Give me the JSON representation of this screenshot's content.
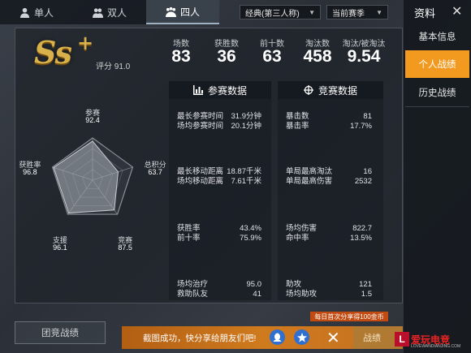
{
  "mode_tabs": [
    {
      "label": "单人",
      "icon": "single-person-icon"
    },
    {
      "label": "双人",
      "icon": "duo-icon"
    },
    {
      "label": "四人",
      "icon": "squad-icon",
      "active": true
    }
  ],
  "perspective_select": {
    "value": "经典(第三人称)"
  },
  "season_select": {
    "value": "当前赛季"
  },
  "side_panel": {
    "title": "资料",
    "items": [
      "基本信息",
      "个人战绩",
      "历史战绩"
    ],
    "active_index": 1
  },
  "rank": {
    "tier": "Ss",
    "plus": "+",
    "score_text": "评分 91.0"
  },
  "summary_stats": [
    {
      "label": "场数",
      "value": "83"
    },
    {
      "label": "获胜数",
      "value": "36"
    },
    {
      "label": "前十数",
      "value": "63"
    },
    {
      "label": "淘汰数",
      "value": "458"
    },
    {
      "label": "淘汰/被淘汰",
      "value": "9.54"
    }
  ],
  "radar": {
    "axes": [
      {
        "label": "参赛",
        "value": "92.4",
        "score": 92.4
      },
      {
        "label": "总积分",
        "value": "63.7",
        "score": 63.7
      },
      {
        "label": "竞赛",
        "value": "87.5",
        "score": 87.5
      },
      {
        "label": "支援",
        "value": "96.1",
        "score": 96.1
      },
      {
        "label": "获胜率",
        "value": "96.8",
        "score": 96.8
      }
    ]
  },
  "participation": {
    "title": "参赛数据",
    "groups": [
      [
        {
          "label": "最长参赛时间",
          "value": "31.9分钟"
        },
        {
          "label": "场均参赛时间",
          "value": "20.1分钟"
        }
      ],
      [
        {
          "label": "最长移动距离",
          "value": "18.87千米"
        },
        {
          "label": "场均移动距离",
          "value": "7.61千米"
        }
      ],
      [
        {
          "label": "获胜率",
          "value": "43.4%"
        },
        {
          "label": "前十率",
          "value": "75.9%"
        }
      ],
      [
        {
          "label": "场均治疗",
          "value": "95.0"
        },
        {
          "label": "救助队友",
          "value": "41"
        }
      ]
    ]
  },
  "competition": {
    "title": "竞赛数据",
    "groups": [
      [
        {
          "label": "暴击数",
          "value": "81"
        },
        {
          "label": "暴击率",
          "value": "17.7%"
        }
      ],
      [
        {
          "label": "单局最高淘汰",
          "value": "16"
        },
        {
          "label": "单局最高伤害",
          "value": "2532"
        }
      ],
      [
        {
          "label": "场均伤害",
          "value": "822.7"
        },
        {
          "label": "命中率",
          "value": "13.5%"
        }
      ],
      [
        {
          "label": "助攻",
          "value": "121"
        },
        {
          "label": "场均助攻",
          "value": "1.5"
        }
      ]
    ]
  },
  "bottom": {
    "team_button": "团竞战绩",
    "share_text": "截图成功，快分享给朋友们吧!",
    "bonus_text": "每日首次分享得100金币",
    "hidden_button": "战绩"
  },
  "watermark": {
    "logo": "L",
    "text": "爱玩电竞",
    "sub": "LOVEWANDIANJING.COM"
  },
  "colors": {
    "accent": "#f29a1f",
    "gold": "#d8b14a",
    "share_bar": "#c97420"
  }
}
